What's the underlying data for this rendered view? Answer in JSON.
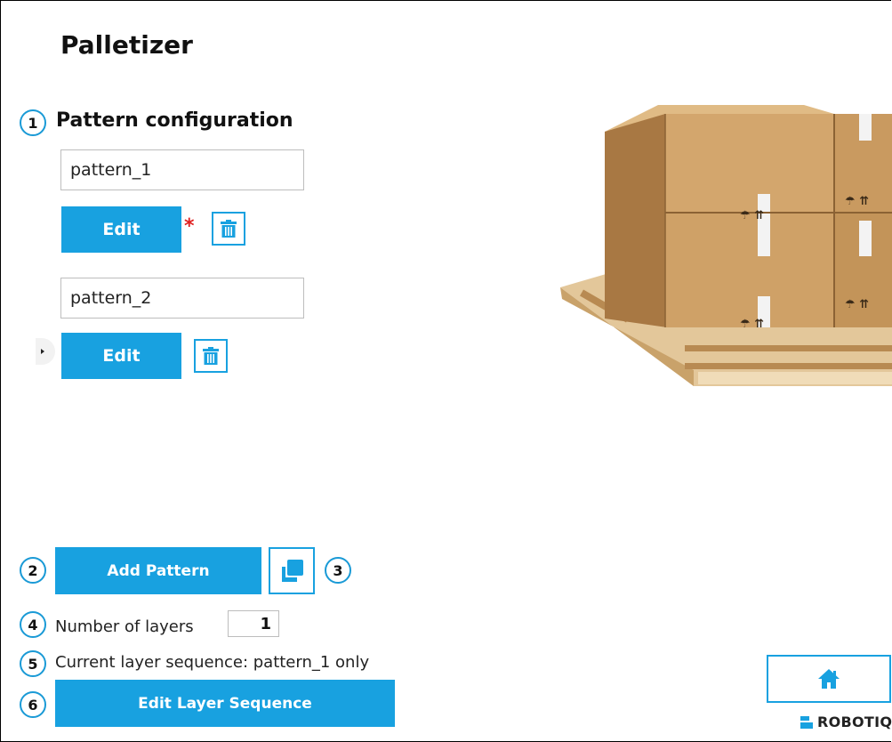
{
  "header": {
    "title": "Palletizer"
  },
  "pattern_section": {
    "title": "Pattern configuration",
    "patterns": [
      {
        "name": "pattern_1",
        "edit_label": "Edit",
        "unsaved_marker": "*"
      },
      {
        "name": "pattern_2",
        "edit_label": "Edit"
      }
    ]
  },
  "actions": {
    "add_pattern_label": "Add Pattern",
    "number_of_layers_label": "Number of layers",
    "number_of_layers_value": "1",
    "layer_sequence_text": "Current layer sequence: pattern_1 only",
    "edit_layer_sequence_label": "Edit Layer Sequence"
  },
  "callouts": [
    "1",
    "2",
    "3",
    "4",
    "5",
    "6"
  ],
  "footer": {
    "brand": "ROBOTIQ"
  },
  "icons": {
    "delete": "trash-icon",
    "duplicate": "copy-icon",
    "home": "home-icon",
    "expand": "chevron-right-icon"
  },
  "colors": {
    "accent": "#18a1e0",
    "required": "#e02020",
    "callout_border": "#1a9ad6"
  }
}
